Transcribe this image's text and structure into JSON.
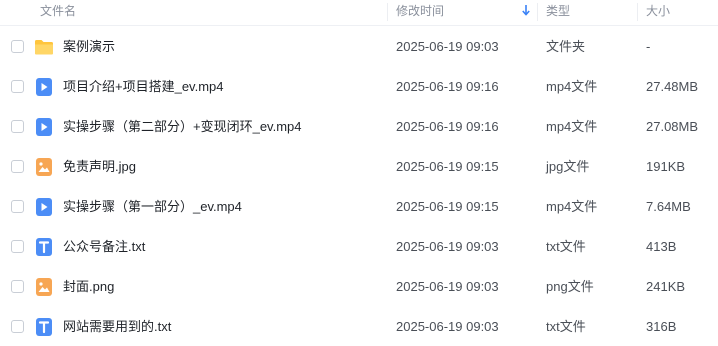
{
  "header": {
    "name": "文件名",
    "modified": "修改时间",
    "type": "类型",
    "size": "大小"
  },
  "colors": {
    "folder": "#FFC53D",
    "video": "#4C8DF6",
    "image": "#F7A654",
    "text": "#4C8DF6",
    "sort_arrow": "#3B82F6"
  },
  "files": [
    {
      "name": "案例演示",
      "modified": "2025-06-19 09:03",
      "type": "文件夹",
      "size": "-",
      "icon": "folder-icon"
    },
    {
      "name": "项目介绍+项目搭建_ev.mp4",
      "modified": "2025-06-19 09:16",
      "type": "mp4文件",
      "size": "27.48MB",
      "icon": "video-file-icon"
    },
    {
      "name": "实操步骤（第二部分）+变现闭环_ev.mp4",
      "modified": "2025-06-19 09:16",
      "type": "mp4文件",
      "size": "27.08MB",
      "icon": "video-file-icon"
    },
    {
      "name": "免责声明.jpg",
      "modified": "2025-06-19 09:15",
      "type": "jpg文件",
      "size": "191KB",
      "icon": "image-file-icon"
    },
    {
      "name": "实操步骤（第一部分）_ev.mp4",
      "modified": "2025-06-19 09:15",
      "type": "mp4文件",
      "size": "7.64MB",
      "icon": "video-file-icon"
    },
    {
      "name": "公众号备注.txt",
      "modified": "2025-06-19 09:03",
      "type": "txt文件",
      "size": "413B",
      "icon": "text-file-icon"
    },
    {
      "name": "封面.png",
      "modified": "2025-06-19 09:03",
      "type": "png文件",
      "size": "241KB",
      "icon": "image-file-icon"
    },
    {
      "name": "网站需要用到的.txt",
      "modified": "2025-06-19 09:03",
      "type": "txt文件",
      "size": "316B",
      "icon": "text-file-icon"
    }
  ]
}
